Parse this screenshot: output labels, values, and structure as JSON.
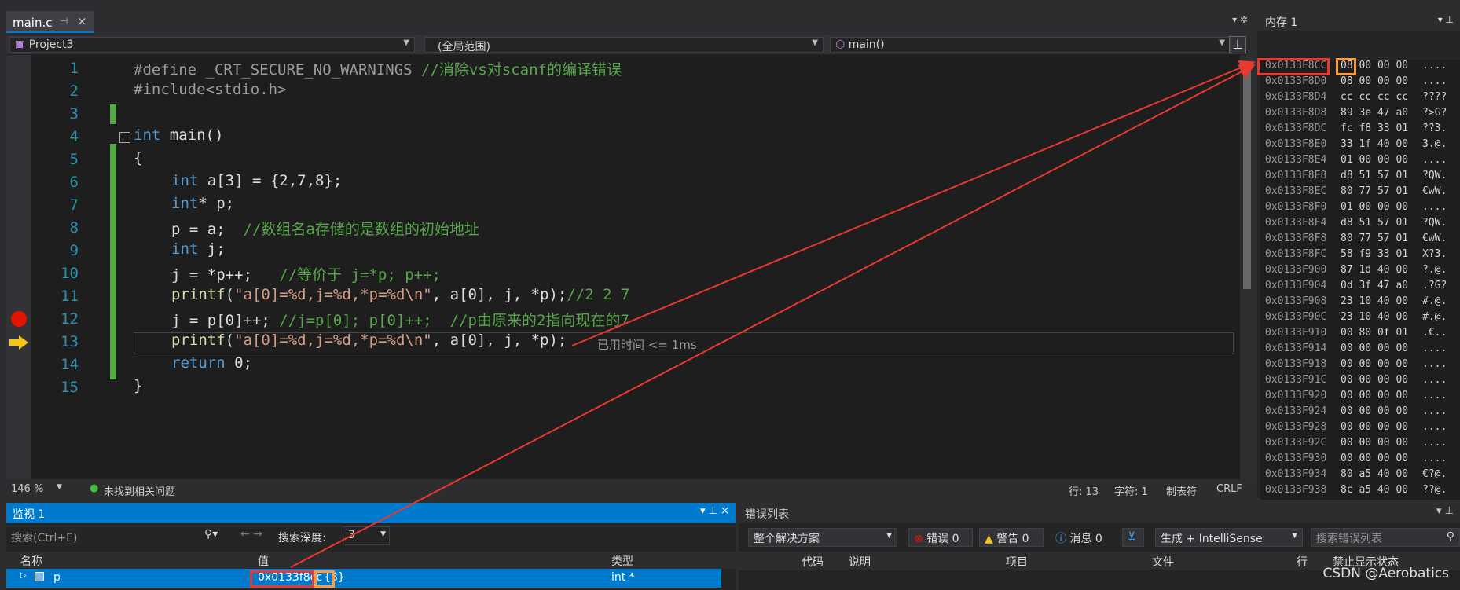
{
  "tab": {
    "title": "main.c",
    "pin": "⊣",
    "close": "×"
  },
  "nav": {
    "project": "Project3",
    "scope": "(全局范围)",
    "func": "main()"
  },
  "code_lines": [
    {
      "n": "1"
    },
    {
      "n": "2"
    },
    {
      "n": "3"
    },
    {
      "n": "4"
    },
    {
      "n": "5"
    },
    {
      "n": "6"
    },
    {
      "n": "7"
    },
    {
      "n": "8"
    },
    {
      "n": "9"
    },
    {
      "n": "10"
    },
    {
      "n": "11"
    },
    {
      "n": "12"
    },
    {
      "n": "13"
    },
    {
      "n": "14"
    },
    {
      "n": "15"
    }
  ],
  "code": {
    "l1_a": "#define _CRT_SECURE_NO_WARNINGS ",
    "l1_b": "//消除vs对scanf的编译错误",
    "l2": "#include<stdio.h>",
    "l4_kw": "int",
    "l4_b": " main()",
    "l5": "{",
    "l6_kw": "int",
    "l6_b": " a[3] = {2,7,8};",
    "l7_kw": "int",
    "l7_b": "* p;",
    "l8_a": "p = a;  ",
    "l8_b": "//数组名a存储的是数组的初始地址",
    "l9_kw": "int",
    "l9_b": " j;",
    "l10_a": "j = *p++;   ",
    "l10_b": "//等价于 j=*p; p++;",
    "l11_fn": "printf",
    "l11_a": "(",
    "l11_st": "\"a[0]=%d,j=%d,*p=%d\\n\"",
    "l11_b": ", a[0], j, *p);",
    "l11_c": "//2 2 7",
    "l12_a": "j = p[0]++; ",
    "l12_b": "//j=p[0]; p[0]++;  //p由原来的2指向现在的7",
    "l13_fn": "printf",
    "l13_a": "(",
    "l13_st": "\"a[0]=%d,j=%d,*p=%d\\n\"",
    "l13_b": ", a[0], j, *p);",
    "l14_kw": "return",
    "l14_b": " 0;",
    "l15": "}"
  },
  "elapsed": "已用时间 <= 1ms",
  "status": {
    "zoom": "146 %",
    "issues": "未找到相关问题",
    "line": "行: 13",
    "char": "字符: 1",
    "tabs": "制表符",
    "eol": "CRLF"
  },
  "memory": {
    "title": "内存 1",
    "rows": [
      {
        "addr": "0x0133F8CC",
        "bytes": "08 00 00 00",
        "chars": "...."
      },
      {
        "addr": "0x0133F8D0",
        "bytes": "08 00 00 00",
        "chars": "...."
      },
      {
        "addr": "0x0133F8D4",
        "bytes": "cc cc cc cc",
        "chars": "????"
      },
      {
        "addr": "0x0133F8D8",
        "bytes": "89 3e 47 a0",
        "chars": "?>G?"
      },
      {
        "addr": "0x0133F8DC",
        "bytes": "fc f8 33 01",
        "chars": "??3."
      },
      {
        "addr": "0x0133F8E0",
        "bytes": "33 1f 40 00",
        "chars": "3.@."
      },
      {
        "addr": "0x0133F8E4",
        "bytes": "01 00 00 00",
        "chars": "...."
      },
      {
        "addr": "0x0133F8E8",
        "bytes": "d8 51 57 01",
        "chars": "?QW."
      },
      {
        "addr": "0x0133F8EC",
        "bytes": "80 77 57 01",
        "chars": "€wW."
      },
      {
        "addr": "0x0133F8F0",
        "bytes": "01 00 00 00",
        "chars": "...."
      },
      {
        "addr": "0x0133F8F4",
        "bytes": "d8 51 57 01",
        "chars": "?QW."
      },
      {
        "addr": "0x0133F8F8",
        "bytes": "80 77 57 01",
        "chars": "€wW."
      },
      {
        "addr": "0x0133F8FC",
        "bytes": "58 f9 33 01",
        "chars": "X?3."
      },
      {
        "addr": "0x0133F900",
        "bytes": "87 1d 40 00",
        "chars": "?.@."
      },
      {
        "addr": "0x0133F904",
        "bytes": "0d 3f 47 a0",
        "chars": ".?G?"
      },
      {
        "addr": "0x0133F908",
        "bytes": "23 10 40 00",
        "chars": "#.@."
      },
      {
        "addr": "0x0133F90C",
        "bytes": "23 10 40 00",
        "chars": "#.@."
      },
      {
        "addr": "0x0133F910",
        "bytes": "00 80 0f 01",
        "chars": ".€.."
      },
      {
        "addr": "0x0133F914",
        "bytes": "00 00 00 00",
        "chars": "...."
      },
      {
        "addr": "0x0133F918",
        "bytes": "00 00 00 00",
        "chars": "...."
      },
      {
        "addr": "0x0133F91C",
        "bytes": "00 00 00 00",
        "chars": "...."
      },
      {
        "addr": "0x0133F920",
        "bytes": "00 00 00 00",
        "chars": "...."
      },
      {
        "addr": "0x0133F924",
        "bytes": "00 00 00 00",
        "chars": "...."
      },
      {
        "addr": "0x0133F928",
        "bytes": "00 00 00 00",
        "chars": "...."
      },
      {
        "addr": "0x0133F92C",
        "bytes": "00 00 00 00",
        "chars": "...."
      },
      {
        "addr": "0x0133F930",
        "bytes": "00 00 00 00",
        "chars": "...."
      },
      {
        "addr": "0x0133F934",
        "bytes": "80 a5 40 00",
        "chars": "€?@."
      },
      {
        "addr": "0x0133F938",
        "bytes": "8c a5 40 00",
        "chars": "??@."
      }
    ]
  },
  "watch": {
    "title": "监视 1",
    "search_placeholder": "搜索(Ctrl+E)",
    "depth_label": "搜索深度:",
    "depth_value": "3",
    "col_name": "名称",
    "col_value": "值",
    "col_type": "类型",
    "row_name": "p",
    "row_value": "0x0133f8cc",
    "row_value2": "{8}",
    "row_type": "int *"
  },
  "errors": {
    "title": "错误列表",
    "scope": "整个解决方案",
    "err": "错误 0",
    "warn": "警告 0",
    "msg": "消息 0",
    "build": "生成 + IntelliSense",
    "search": "搜索错误列表",
    "col_code": "代码",
    "col_desc": "说明",
    "col_proj": "项目",
    "col_file": "文件",
    "col_line": "行",
    "col_suppress": "禁止显示状态"
  },
  "watermark": "CSDN @Aerobatics"
}
